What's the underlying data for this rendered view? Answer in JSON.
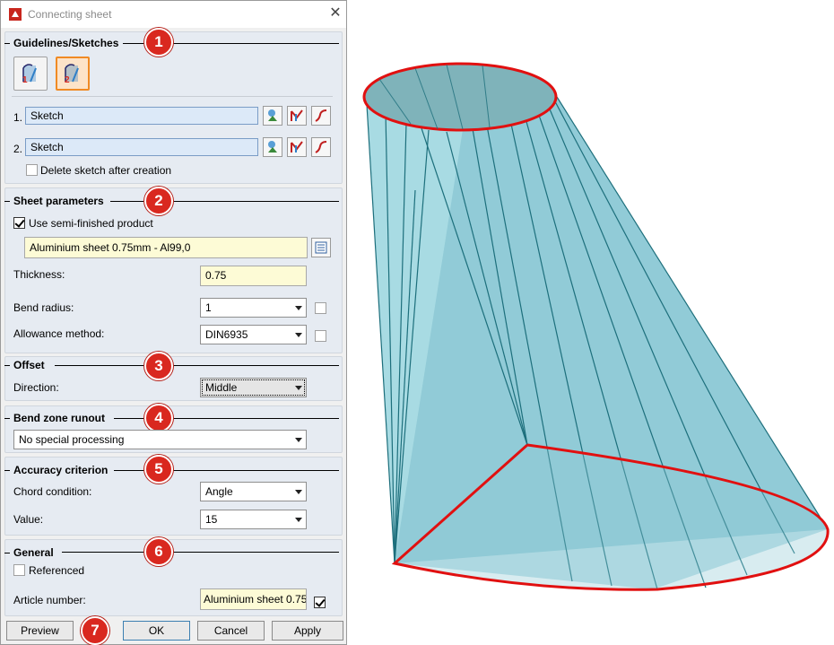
{
  "window": {
    "title": "Connecting sheet",
    "close_symbol": "✕"
  },
  "sections": {
    "guidelines": {
      "title": "Guidelines/Sketches",
      "badge": "1",
      "rows": [
        {
          "index": "1.",
          "value": "Sketch"
        },
        {
          "index": "2.",
          "value": "Sketch"
        }
      ],
      "delete_sketch_label": "Delete sketch after creation",
      "big_button_1_num": "1",
      "big_button_2_num": "2"
    },
    "sheet": {
      "title": "Sheet parameters",
      "badge": "2",
      "use_semi_label": "Use semi-finished product",
      "material": "Aluminium sheet 0.75mm - Al99,0",
      "thickness_label": "Thickness:",
      "thickness": "0.75",
      "bend_radius_label": "Bend radius:",
      "bend_radius": "1",
      "allowance_label": "Allowance method:",
      "allowance": "DIN6935"
    },
    "offset": {
      "title": "Offset",
      "badge": "3",
      "direction_label": "Direction:",
      "direction": "Middle"
    },
    "bendzone": {
      "title": "Bend zone runout",
      "badge": "4",
      "value": "No special processing"
    },
    "accuracy": {
      "title": "Accuracy criterion",
      "badge": "5",
      "chord_label": "Chord condition:",
      "chord": "Angle",
      "value_label": "Value:",
      "value": "15"
    },
    "general": {
      "title": "General",
      "badge": "6",
      "referenced_label": "Referenced",
      "article_label": "Article number:",
      "article": "Aluminium sheet 0.75"
    }
  },
  "footer": {
    "preview": "Preview",
    "badge": "7",
    "ok": "OK",
    "cancel": "Cancel",
    "apply": "Apply"
  },
  "colors": {
    "badge": "#d9281f",
    "sheet_fill": "#8ec9d4",
    "sheet_edge": "#1d6f7c",
    "curve": "#e11010",
    "active_button": "#f08a24"
  },
  "icons": [
    "app-icon",
    "close-icon",
    "sketch-1-icon",
    "sketch-2-icon",
    "pick-sketch-icon",
    "edit-sketch-icon",
    "curve-sketch-icon",
    "catalog-icon",
    "dropdown-arrow-icon",
    "checkbox-icon"
  ]
}
